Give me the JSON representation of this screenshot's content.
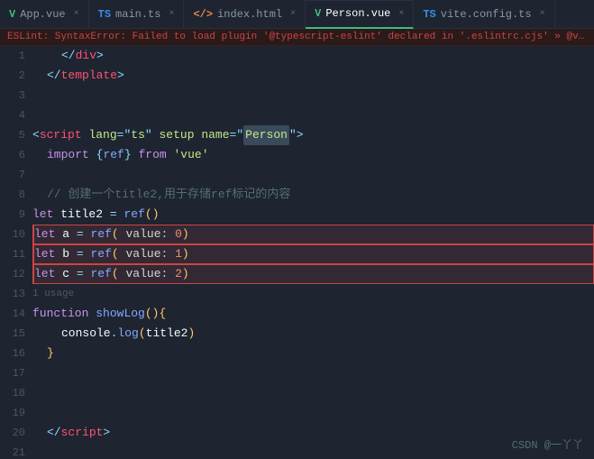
{
  "tabs": [
    {
      "id": "app-vue",
      "label": "App.vue",
      "icon": "vue-icon",
      "iconColor": "#42b883",
      "active": false
    },
    {
      "id": "main-ts",
      "label": "main.ts",
      "icon": "ts-icon",
      "iconColor": "#3b8eea",
      "active": false
    },
    {
      "id": "index-html",
      "label": "index.html",
      "icon": "html-icon",
      "iconColor": "#e8834d",
      "active": false
    },
    {
      "id": "person-vue",
      "label": "Person.vue",
      "icon": "vue-icon",
      "iconColor": "#42b883",
      "active": true
    },
    {
      "id": "vite-config-ts",
      "label": "vite.config.ts",
      "icon": "ts-icon",
      "iconColor": "#3b8eea",
      "active": false
    }
  ],
  "error_bar": {
    "text": "ESLint: SyntaxError: Failed to load plugin '@typescript-eslint' declared in '.eslintrc.cjs' » @vue/eslint-config-typesc"
  },
  "line_numbers": [
    1,
    2,
    3,
    4,
    5,
    6,
    7,
    8,
    9,
    10,
    11,
    12,
    13,
    14,
    15,
    16,
    17,
    18,
    19,
    20,
    21
  ],
  "footer": {
    "text": "CSDN @一丫丫"
  }
}
